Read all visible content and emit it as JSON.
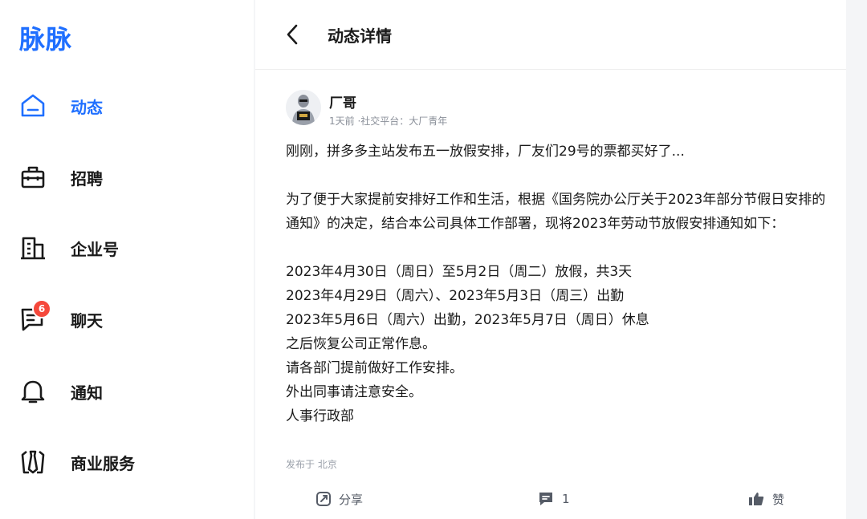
{
  "brand": {
    "logo_text": "脉脉",
    "accent": "#1f6fff"
  },
  "sidebar": {
    "items": [
      {
        "label": "动态",
        "icon": "home-icon",
        "active": true
      },
      {
        "label": "招聘",
        "icon": "briefcase-icon"
      },
      {
        "label": "企业号",
        "icon": "building-icon"
      },
      {
        "label": "聊天",
        "icon": "chat-icon",
        "badge": "6"
      },
      {
        "label": "通知",
        "icon": "bell-icon"
      },
      {
        "label": "商业服务",
        "icon": "tie-icon"
      }
    ]
  },
  "header": {
    "title": "动态详情",
    "back_icon": "chevron-left-icon"
  },
  "post": {
    "author_name": "厂哥",
    "meta": "1天前 ·社交平台：大厂青年",
    "paragraphs": [
      [
        "刚刚，拼多多主站发布五一放假安排，厂友们29号的票都买好了..."
      ],
      [
        "为了便于大家提前安排好工作和生活，根据《国务院办公厅关于2023年部分节假日安排的通知》的决定，结合本公司具体工作部署，现将2023年劳动节放假安排通知如下："
      ],
      [
        "2023年4月30日（周日）至5月2日（周二）放假，共3天",
        "2023年4月29日（周六）、2023年5月3日（周三）出勤",
        "2023年5月6日（周六）出勤，2023年5月7日（周日）休息",
        "之后恢复公司正常作息。",
        "请各部门提前做好工作安排。",
        "外出同事请注意安全。",
        "人事行政部"
      ]
    ],
    "location": "发布于 北京"
  },
  "actions": {
    "share_label": "分享",
    "comment_count": "1",
    "like_label": "赞"
  },
  "colors": {
    "badge": "#f5483b",
    "muted": "#8a8f99"
  }
}
